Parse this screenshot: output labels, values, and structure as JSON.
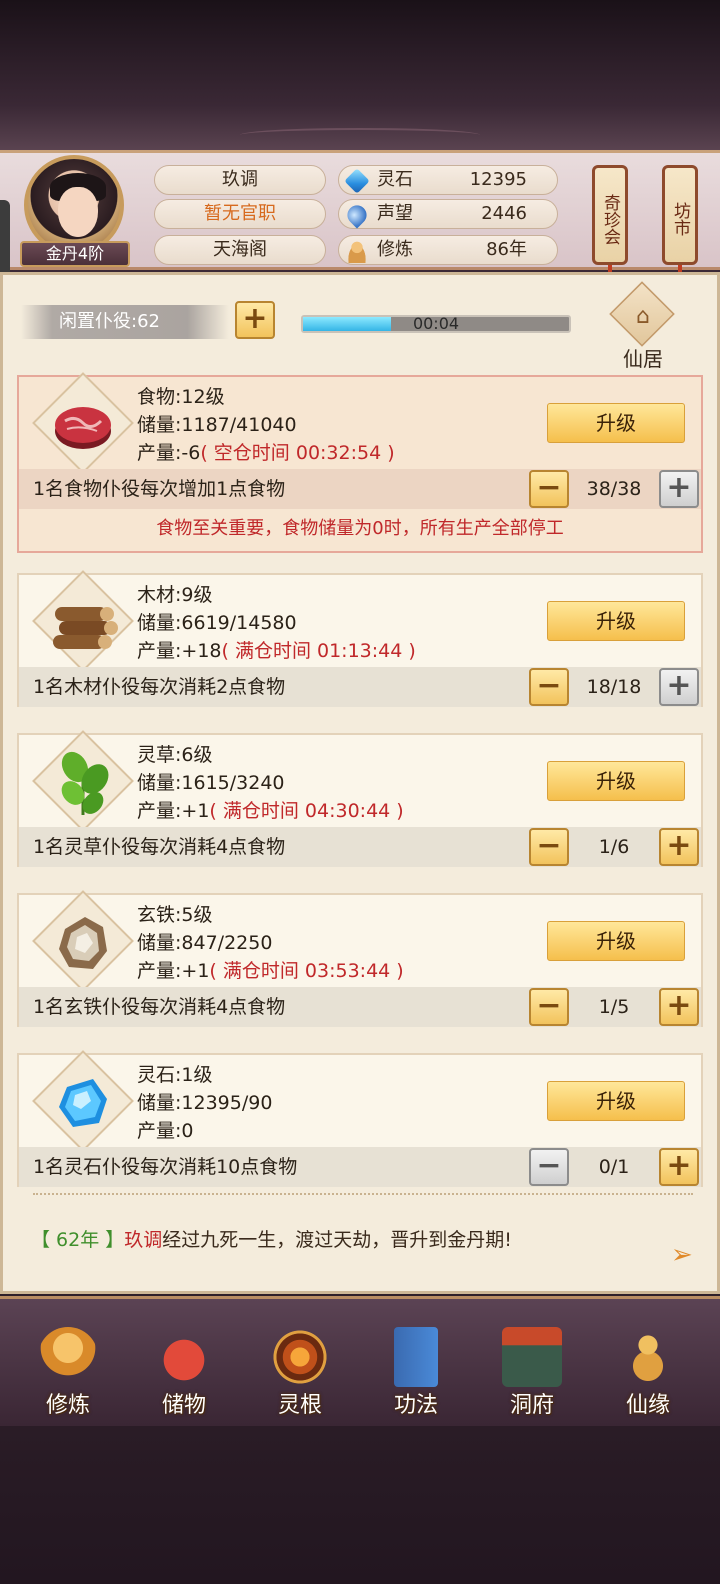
{
  "player": {
    "rank": "金丹4阶",
    "name": "玖调",
    "post": "暂无官职",
    "sect": "天海阁"
  },
  "resources": [
    {
      "label": "灵石",
      "value": "12395",
      "icon": "spirit-stone-icon"
    },
    {
      "label": "声望",
      "value": "2446",
      "icon": "prestige-icon"
    },
    {
      "label": "修炼",
      "value": "86年",
      "icon": "meditation-icon"
    }
  ],
  "banners": {
    "left": "奇珍会",
    "right": "坊市"
  },
  "idle": {
    "label": "闲置仆役:62",
    "timer": "00:04",
    "progress": 0.33
  },
  "xianju": {
    "label": "仙居"
  },
  "upgrade_label": "升级",
  "cards": [
    {
      "name": "食物:12级",
      "storage": "储量:1187/41040",
      "prod": "产量:-6",
      "prod_note": "( 空仓时间 00:32:54 )",
      "desc": "1名食物仆役每次增加1点食物",
      "count": "38/38",
      "icon": "meat-icon"
    },
    {
      "name": "木材:9级",
      "storage": "储量:6619/14580",
      "prod": "产量:+18",
      "prod_note": "( 满仓时间 01:13:44 )",
      "desc": "1名木材仆役每次消耗2点食物",
      "count": "18/18",
      "icon": "wood-icon"
    },
    {
      "name": "灵草:6级",
      "storage": "储量:1615/3240",
      "prod": "产量:+1",
      "prod_note": "( 满仓时间 04:30:44 )",
      "desc": "1名灵草仆役每次消耗4点食物",
      "count": "1/6",
      "icon": "herb-icon"
    },
    {
      "name": "玄铁:5级",
      "storage": "储量:847/2250",
      "prod": "产量:+1",
      "prod_note": "( 满仓时间 03:53:44 )",
      "desc": "1名玄铁仆役每次消耗4点食物",
      "count": "1/5",
      "icon": "iron-ore-icon"
    },
    {
      "name": "灵石:1级",
      "storage": "储量:12395/90",
      "prod": "产量:0",
      "prod_note": "",
      "desc": "1名灵石仆役每次消耗10点食物",
      "count": "0/1",
      "icon": "spirit-crystal-icon"
    }
  ],
  "warning": "食物至关重要，食物储量为0时，所有生产全部停工",
  "log": {
    "year": "【 62年 】",
    "name": "玖调",
    "text": "经过九死一生，渡过天劫，晋升到金丹期!"
  },
  "nav": [
    {
      "label": "修炼",
      "icon": "cultivate-icon"
    },
    {
      "label": "储物",
      "icon": "storage-bag-icon"
    },
    {
      "label": "灵根",
      "icon": "spirit-root-icon"
    },
    {
      "label": "功法",
      "icon": "scripture-icon"
    },
    {
      "label": "洞府",
      "icon": "cave-mansion-icon"
    },
    {
      "label": "仙缘",
      "icon": "gourd-icon"
    }
  ],
  "colors": {
    "accent_gold": "#f5bf4c",
    "alert_red": "#c0282a",
    "year_green": "#3f8f2c"
  }
}
